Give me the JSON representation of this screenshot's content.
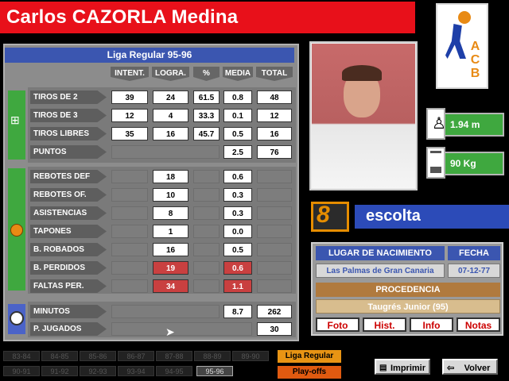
{
  "player_name": "Carlos CAZORLA Medina",
  "stats": {
    "season_title": "Liga Regular 95-96",
    "columns": [
      "INTENT.",
      "LOGRA.",
      "%",
      "MEDIA",
      "TOTAL"
    ],
    "rows": [
      {
        "label": "TIROS DE 2",
        "values": [
          "39",
          "24",
          "61.5",
          "0.8",
          "48"
        ]
      },
      {
        "label": "TIROS DE 3",
        "values": [
          "12",
          "4",
          "33.3",
          "0.1",
          "12"
        ]
      },
      {
        "label": "TIROS LIBRES",
        "values": [
          "35",
          "16",
          "45.7",
          "0.5",
          "16"
        ]
      },
      {
        "label": "PUNTOS",
        "values": [
          "",
          "",
          "",
          "2.5",
          "76"
        ]
      },
      {
        "label": "REBOTES DEF",
        "values": [
          "",
          "18",
          "",
          "0.6",
          ""
        ]
      },
      {
        "label": "REBOTES OF.",
        "values": [
          "",
          "10",
          "",
          "0.3",
          ""
        ]
      },
      {
        "label": "ASISTENCIAS",
        "values": [
          "",
          "8",
          "",
          "0.3",
          ""
        ]
      },
      {
        "label": "TAPONES",
        "values": [
          "",
          "1",
          "",
          "0.0",
          ""
        ]
      },
      {
        "label": "B. ROBADOS",
        "values": [
          "",
          "16",
          "",
          "0.5",
          ""
        ]
      },
      {
        "label": "B. PERDIDOS",
        "values": [
          "",
          "19",
          "",
          "0.6",
          ""
        ]
      },
      {
        "label": "FALTAS PER.",
        "values": [
          "",
          "34",
          "",
          "1.1",
          ""
        ]
      },
      {
        "label": "MINUTOS",
        "values": [
          "",
          "",
          "",
          "8.7",
          "262"
        ]
      },
      {
        "label": "P. JUGADOS",
        "values": [
          "",
          "",
          "",
          "",
          "30"
        ]
      }
    ]
  },
  "logo_text": "ACB",
  "height": "1.94 m",
  "weight": "90 Kg",
  "jersey_number": "8",
  "position": "escolta",
  "info": {
    "birthplace_header": "LUGAR DE NACIMIENTO",
    "date_header": "FECHA",
    "birthplace": "Las Palmas de Gran Canaria",
    "birth_date": "07-12-77",
    "origin_header": "PROCEDENCIA",
    "origin": "Taugrés Junior (95)",
    "buttons": [
      "Foto",
      "Hist.",
      "Info",
      "Notas"
    ]
  },
  "seasons": [
    "83-84",
    "84-85",
    "85-86",
    "86-87",
    "87-88",
    "88-89",
    "89-90",
    "90-91",
    "91-92",
    "92-93",
    "93-94",
    "94-95",
    "95-96"
  ],
  "mode_buttons": [
    "Liga Regular",
    "Play-offs"
  ],
  "action_buttons": [
    "Imprimir",
    "Volver"
  ]
}
